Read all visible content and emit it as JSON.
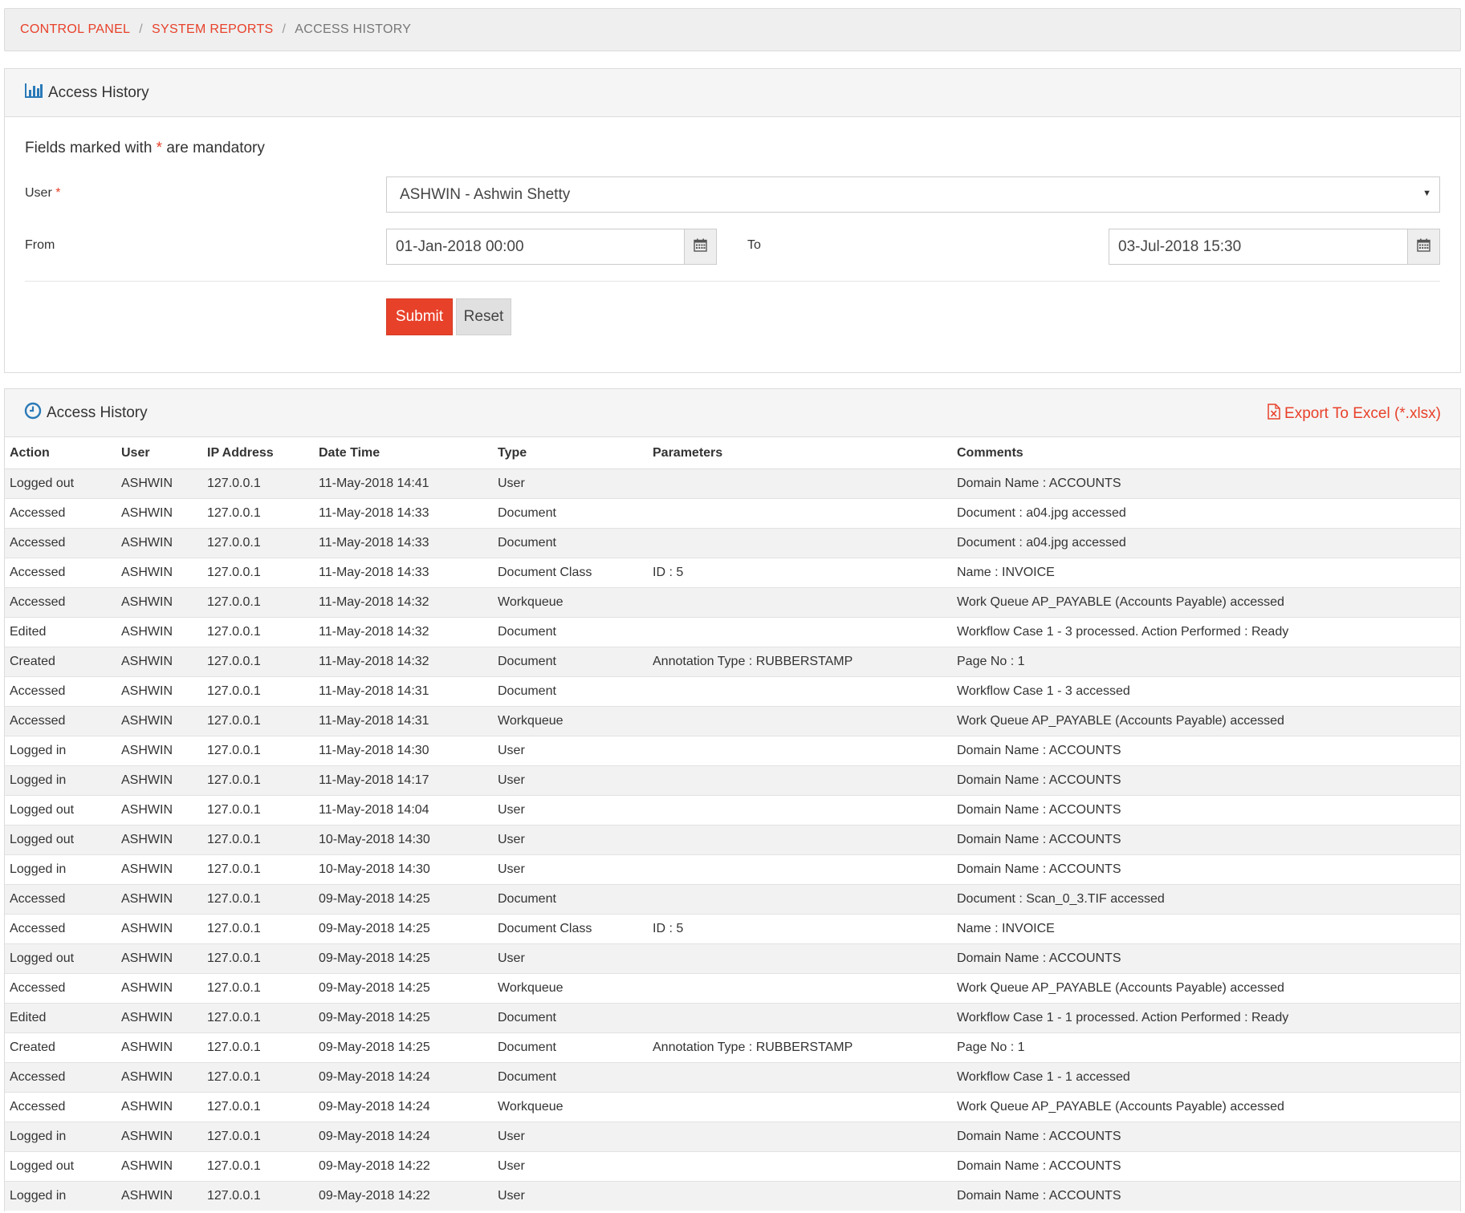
{
  "breadcrumb": {
    "items": [
      {
        "label": "CONTROL PANEL"
      },
      {
        "label": "SYSTEM REPORTS"
      }
    ],
    "current": "ACCESS HISTORY",
    "separator": "/"
  },
  "form_panel": {
    "title": "Access History",
    "mandatory_prefix": "Fields marked with",
    "mandatory_star": "*",
    "mandatory_suffix": "are mandatory",
    "user_label": "User",
    "user_value": "ASHWIN - Ashwin Shetty",
    "from_label": "From",
    "from_value": "01-Jan-2018 00:00",
    "to_label": "To",
    "to_value": "03-Jul-2018 15:30",
    "submit_label": "Submit",
    "reset_label": "Reset"
  },
  "history_panel": {
    "title": "Access History",
    "export_label": "Export To Excel (*.xlsx)",
    "columns": [
      "Action",
      "User",
      "IP Address",
      "Date Time",
      "Type",
      "Parameters",
      "Comments"
    ],
    "rows": [
      [
        "Logged out",
        "ASHWIN",
        "127.0.0.1",
        "11-May-2018 14:41",
        "User",
        "",
        "Domain Name : ACCOUNTS"
      ],
      [
        "Accessed",
        "ASHWIN",
        "127.0.0.1",
        "11-May-2018 14:33",
        "Document",
        "",
        "Document : a04.jpg accessed"
      ],
      [
        "Accessed",
        "ASHWIN",
        "127.0.0.1",
        "11-May-2018 14:33",
        "Document",
        "",
        "Document : a04.jpg accessed"
      ],
      [
        "Accessed",
        "ASHWIN",
        "127.0.0.1",
        "11-May-2018 14:33",
        "Document Class",
        "ID : 5",
        "Name : INVOICE"
      ],
      [
        "Accessed",
        "ASHWIN",
        "127.0.0.1",
        "11-May-2018 14:32",
        "Workqueue",
        "",
        "Work Queue AP_PAYABLE (Accounts Payable) accessed"
      ],
      [
        "Edited",
        "ASHWIN",
        "127.0.0.1",
        "11-May-2018 14:32",
        "Document",
        "",
        "Workflow Case 1 - 3 processed. Action Performed : Ready"
      ],
      [
        "Created",
        "ASHWIN",
        "127.0.0.1",
        "11-May-2018 14:32",
        "Document",
        "Annotation Type : RUBBERSTAMP",
        "Page No : 1"
      ],
      [
        "Accessed",
        "ASHWIN",
        "127.0.0.1",
        "11-May-2018 14:31",
        "Document",
        "",
        "Workflow Case 1 - 3 accessed"
      ],
      [
        "Accessed",
        "ASHWIN",
        "127.0.0.1",
        "11-May-2018 14:31",
        "Workqueue",
        "",
        "Work Queue AP_PAYABLE (Accounts Payable) accessed"
      ],
      [
        "Logged in",
        "ASHWIN",
        "127.0.0.1",
        "11-May-2018 14:30",
        "User",
        "",
        "Domain Name : ACCOUNTS"
      ],
      [
        "Logged in",
        "ASHWIN",
        "127.0.0.1",
        "11-May-2018 14:17",
        "User",
        "",
        "Domain Name : ACCOUNTS"
      ],
      [
        "Logged out",
        "ASHWIN",
        "127.0.0.1",
        "11-May-2018 14:04",
        "User",
        "",
        "Domain Name : ACCOUNTS"
      ],
      [
        "Logged out",
        "ASHWIN",
        "127.0.0.1",
        "10-May-2018 14:30",
        "User",
        "",
        "Domain Name : ACCOUNTS"
      ],
      [
        "Logged in",
        "ASHWIN",
        "127.0.0.1",
        "10-May-2018 14:30",
        "User",
        "",
        "Domain Name : ACCOUNTS"
      ],
      [
        "Accessed",
        "ASHWIN",
        "127.0.0.1",
        "09-May-2018 14:25",
        "Document",
        "",
        "Document : Scan_0_3.TIF accessed"
      ],
      [
        "Accessed",
        "ASHWIN",
        "127.0.0.1",
        "09-May-2018 14:25",
        "Document Class",
        "ID : 5",
        "Name : INVOICE"
      ],
      [
        "Logged out",
        "ASHWIN",
        "127.0.0.1",
        "09-May-2018 14:25",
        "User",
        "",
        "Domain Name : ACCOUNTS"
      ],
      [
        "Accessed",
        "ASHWIN",
        "127.0.0.1",
        "09-May-2018 14:25",
        "Workqueue",
        "",
        "Work Queue AP_PAYABLE (Accounts Payable) accessed"
      ],
      [
        "Edited",
        "ASHWIN",
        "127.0.0.1",
        "09-May-2018 14:25",
        "Document",
        "",
        "Workflow Case 1 - 1 processed. Action Performed : Ready"
      ],
      [
        "Created",
        "ASHWIN",
        "127.0.0.1",
        "09-May-2018 14:25",
        "Document",
        "Annotation Type : RUBBERSTAMP",
        "Page No : 1"
      ],
      [
        "Accessed",
        "ASHWIN",
        "127.0.0.1",
        "09-May-2018 14:24",
        "Document",
        "",
        "Workflow Case 1 - 1 accessed"
      ],
      [
        "Accessed",
        "ASHWIN",
        "127.0.0.1",
        "09-May-2018 14:24",
        "Workqueue",
        "",
        "Work Queue AP_PAYABLE (Accounts Payable) accessed"
      ],
      [
        "Logged in",
        "ASHWIN",
        "127.0.0.1",
        "09-May-2018 14:24",
        "User",
        "",
        "Domain Name : ACCOUNTS"
      ],
      [
        "Logged out",
        "ASHWIN",
        "127.0.0.1",
        "09-May-2018 14:22",
        "User",
        "",
        "Domain Name : ACCOUNTS"
      ],
      [
        "Logged in",
        "ASHWIN",
        "127.0.0.1",
        "09-May-2018 14:22",
        "User",
        "",
        "Domain Name : ACCOUNTS"
      ]
    ]
  },
  "colors": {
    "accent": "#e8412a",
    "icon_blue": "#2a7ab8",
    "panel_header_bg": "#f5f5f5",
    "row_stripe": "#f2f2f2"
  },
  "icons": {
    "form_panel_icon": "bar-chart-icon",
    "history_panel_icon": "clock-icon",
    "export_icon": "excel-file-icon",
    "calendar_icon": "calendar-icon",
    "select_caret": "caret-down-icon"
  }
}
